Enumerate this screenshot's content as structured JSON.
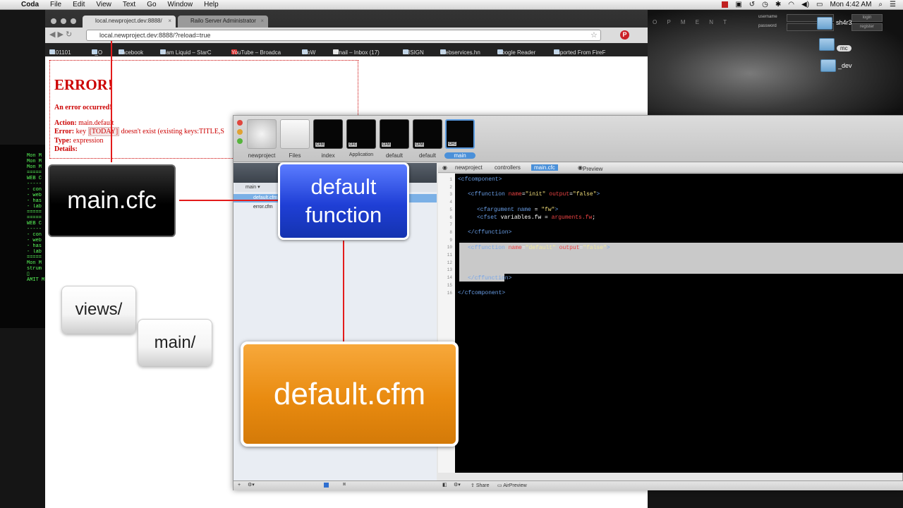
{
  "menubar": {
    "apple": "",
    "app_name": "Coda",
    "items": [
      "File",
      "Edit",
      "View",
      "Text",
      "Go",
      "Window",
      "Help"
    ],
    "clock": "Mon 4:42 AM"
  },
  "desktop": {
    "banner_text": "O P M E N T",
    "login": {
      "username_label": "username",
      "password_label": "password",
      "login_button": "login",
      "register_button": "register"
    },
    "folders": [
      {
        "label": "sh4r3"
      },
      {
        "label": "mc"
      },
      {
        "label": "_dev"
      }
    ]
  },
  "terminal": {
    "lines": [
      "Mon M",
      "Mon M",
      "Mon M",
      "=====",
      "WEB C",
      "-----",
      "- con",
      "- web",
      "- has",
      "- lab",
      "=====",
      "",
      "=====",
      "WEB C",
      "-----",
      "- con",
      "- web",
      "- has",
      "- lab",
      "=====",
      "",
      "Mon M",
      "strum",
      "▯",
      "AMIT M"
    ]
  },
  "browser": {
    "tabs": [
      {
        "title": "local.newproject.dev:8888/"
      },
      {
        "title": "Railo Server Administrator"
      }
    ],
    "url": "local.newproject.dev:8888/?reload=true",
    "bookmarks": [
      "0101101",
      "o_O",
      "Facebook",
      "Team Liquid – StarC",
      "YouTube – Broadca",
      "WoW",
      "Gmail – Inbox (17)",
      "D3SIGN",
      "Webservices.hn",
      "Google Reader",
      "Imported From FireF"
    ],
    "error": {
      "title": "ERROR!",
      "subtitle": "An error occurred!",
      "action_label": "Action:",
      "action_value": "main.default",
      "error_label": "Error:",
      "error_pre": "key",
      "error_key": "[TODAY]",
      "error_post": "doesn't exist (existing keys:TITLE,S",
      "type_label": "Type:",
      "type_value": "expression",
      "details_label": "Details:"
    }
  },
  "coda": {
    "thumbnails": [
      {
        "label": "newproject",
        "badge": ""
      },
      {
        "label": "Files",
        "badge": ""
      },
      {
        "label": "index",
        "badge": "CFM"
      },
      {
        "label": "Application",
        "badge": "CFC"
      },
      {
        "label": "default",
        "badge": "CFM"
      },
      {
        "label": "default",
        "badge": "CFM"
      },
      {
        "label": "main",
        "badge": "CFC"
      }
    ],
    "sidebar": {
      "folder": "main",
      "files": [
        "default.cfm",
        "error.cfm"
      ]
    },
    "path": {
      "crumbs": [
        "newproject",
        "controllers"
      ],
      "current": "main.cfc",
      "preview": "Preview"
    },
    "line_numbers": [
      "1",
      "2",
      "3",
      "4",
      "5",
      "6",
      "7",
      "8",
      "9",
      "10",
      "11",
      "12",
      "13",
      "14",
      "15",
      "16"
    ],
    "code": {
      "l1": "<cfcomponent>",
      "l3_tag": "<cffunction",
      "l3_a1": "name",
      "l3_v1": "\"init\"",
      "l3_a2": "output",
      "l3_v2": "\"false\"",
      "l3_end": ">",
      "l5_tag": "<cfargument",
      "l5_a1": "name",
      "l5_eq": " = ",
      "l5_v1": "\"fw\"",
      "l5_end": ">",
      "l6_tag": "<cfset",
      "l6_var": "variables.fw",
      "l6_eq": " = ",
      "l6_val": "arguments.fw",
      "l6_end": ";",
      "l8": "</cffunction>",
      "l10_tag": "<cffunction",
      "l10_a1": "name",
      "l10_v1": "\"default\"",
      "l10_a2": "output",
      "l10_v2": "\"false\"",
      "l10_end": ">",
      "l14": "</cffunction>",
      "l16": "</cfcomponent>"
    },
    "status": {
      "share": "Share",
      "airpreview": "AirPreview"
    }
  },
  "callouts": {
    "main_cfc": "main.cfc",
    "default_function": "default function",
    "default_cfm": "default.cfm",
    "views": "views/",
    "main": "main/"
  },
  "colors": {
    "error_red": "#cc0000",
    "callout_blue": "#1f3fd6",
    "callout_orange": "#e98b10",
    "connector_red": "#e31b1b"
  }
}
